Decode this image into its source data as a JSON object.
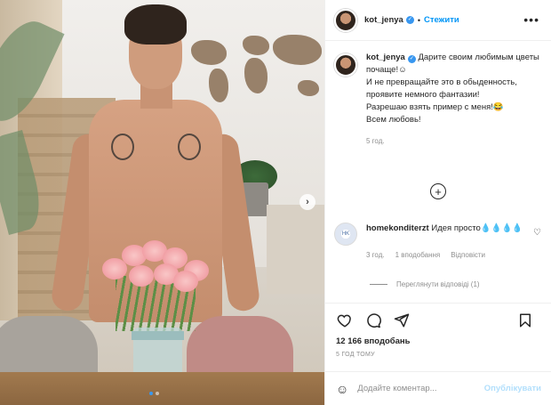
{
  "header": {
    "username": "kot_jenya",
    "separator": "•",
    "follow_label": "Стежити",
    "more_icon": "more-horizontal-icon"
  },
  "caption": {
    "username": "kot_jenya",
    "lines": [
      "Дарите своим любимым цветы почаще!☺",
      "И не превращайте это в обыденность, проявите немного фантазии!",
      "Разрешаю взять пример с меня!😂",
      "Всем любовь!"
    ],
    "time": "5 год."
  },
  "load_more_icon": "plus-circle-icon",
  "comment": {
    "username": "homekonditerzt",
    "text": "Идея просто💧💧💧💧",
    "time": "3 год.",
    "likes": "1 вподобання",
    "reply_label": "Відповісти",
    "avatar_text": "HK"
  },
  "view_replies_label": "Переглянути відповіді (1)",
  "actions": {
    "like_icon": "heart-icon",
    "comment_icon": "comment-icon",
    "share_icon": "paper-plane-icon",
    "save_icon": "bookmark-icon"
  },
  "likes_label": "12 166 вподобань",
  "post_time": "5 ГОД ТОМУ",
  "comment_box": {
    "emoji_icon": "smiley-icon",
    "placeholder": "Додайте коментар...",
    "publish_label": "Опублікувати"
  },
  "media": {
    "next_icon": "chevron-right-icon",
    "slides_total": 2,
    "active_slide": 1
  },
  "colors": {
    "accent": "#0095f6",
    "muted": "#8e8e8e",
    "publish_disabled": "#b2dffc",
    "verified": "#3897f0"
  }
}
